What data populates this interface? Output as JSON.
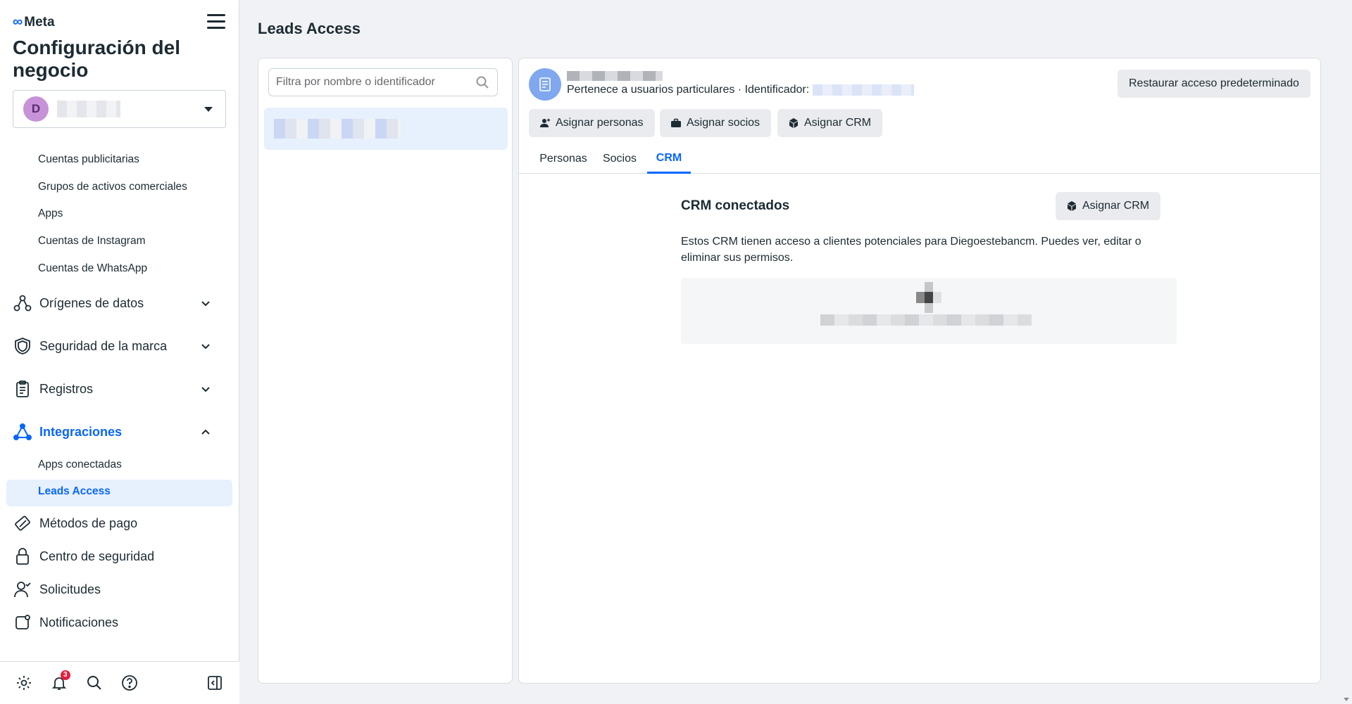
{
  "brand": {
    "logo_text": "Meta"
  },
  "sidebar": {
    "title": "Configuración del negocio",
    "account_initial": "D",
    "subitems_top": [
      "Cuentas publicitarias",
      "Grupos de activos comerciales",
      "Apps",
      "Cuentas de Instagram",
      "Cuentas de WhatsApp"
    ],
    "sections": {
      "data_sources": "Orígenes de datos",
      "brand_safety": "Seguridad de la marca",
      "logs": "Registros",
      "integrations": "Integraciones"
    },
    "integration_items": [
      "Apps conectadas",
      "Leads Access"
    ],
    "bottom_sections": {
      "payment": "Métodos de pago",
      "security_center": "Centro de seguridad",
      "requests": "Solicitudes",
      "notifications": "Notificaciones"
    },
    "notification_badge": "3"
  },
  "main": {
    "page_title": "Leads Access",
    "search": {
      "placeholder": "Filtra por nombre o identificador"
    },
    "detail": {
      "owner_text": "Pertenece a usuarios particulares · Identificador:",
      "restore_button": "Restaurar acceso predeterminado",
      "assign_people": "Asignar personas",
      "assign_partners": "Asignar socios",
      "assign_crm": "Asignar CRM",
      "tabs": [
        "Personas",
        "Socios",
        "CRM"
      ],
      "active_tab": "CRM",
      "crm_section_title": "CRM conectados",
      "crm_assign_button": "Asignar CRM",
      "crm_description": "Estos CRM tienen acceso a clientes potenciales para Diegoestebancm. Puedes ver, editar o eliminar sus permisos."
    }
  },
  "colors": {
    "accent": "#0866ff",
    "active_bg": "#e7f0fd",
    "button_bg": "#e9ebee",
    "page_bg": "#f0f2f5"
  }
}
